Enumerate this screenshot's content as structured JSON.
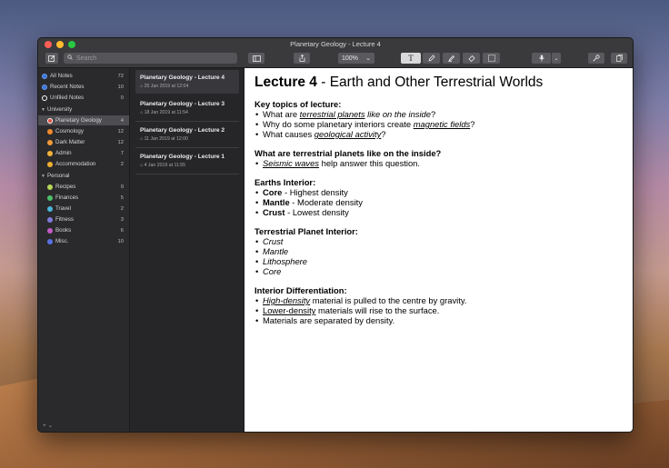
{
  "window": {
    "title": "Planetary Geology - Lecture 4"
  },
  "toolbar": {
    "search_placeholder": "Search",
    "zoom": "100%",
    "zoom_caret": "⌄"
  },
  "sidebar": {
    "top_items": [
      {
        "label": "All Notes",
        "count": "72",
        "color": "#3a76d8"
      },
      {
        "label": "Recent Notes",
        "count": "10",
        "color": "#3a76d8"
      },
      {
        "label": "Unfiled Notes",
        "count": "0",
        "color": "#ffffff"
      }
    ],
    "groups": [
      {
        "label": "University",
        "items": [
          {
            "label": "Planetary Geology",
            "count": "4",
            "color": "#e04b3c",
            "selected": true
          },
          {
            "label": "Cosmology",
            "count": "12",
            "color": "#ef8a2c"
          },
          {
            "label": "Dark Matter",
            "count": "12",
            "color": "#f09a3a"
          },
          {
            "label": "Admin",
            "count": "7",
            "color": "#f3b23a"
          },
          {
            "label": "Accommodation",
            "count": "2",
            "color": "#f0b030"
          }
        ]
      },
      {
        "label": "Personal",
        "items": [
          {
            "label": "Recipes",
            "count": "9",
            "color": "#b6d65a"
          },
          {
            "label": "Finances",
            "count": "5",
            "color": "#4cc16a"
          },
          {
            "label": "Travel",
            "count": "2",
            "color": "#4ab6d9"
          },
          {
            "label": "Fitness",
            "count": "3",
            "color": "#7f7cdb"
          },
          {
            "label": "Books",
            "count": "6",
            "color": "#c35cc8"
          },
          {
            "label": "Misc.",
            "count": "10",
            "color": "#5a6fe0"
          }
        ]
      }
    ],
    "footer": "+ ⌄"
  },
  "notes": [
    {
      "title": "Planetary Geology - Lecture 4",
      "date": "25 Jan 2019 at 12:04",
      "selected": true
    },
    {
      "title": "Planetary Geology - Lecture 3",
      "date": "18 Jan 2019 at 11:54"
    },
    {
      "title": "Planetary Geology - Lecture 2",
      "date": "11 Jan 2019 at 12:00"
    },
    {
      "title": "Planetary Geology - Lecture 1",
      "date": "4 Jan 2019 at 11:55"
    }
  ],
  "editor": {
    "title_bold": "Lecture 4",
    "title_rest": " - Earth and Other Terrestrial Worlds",
    "s1": {
      "heading": "Key topics of lecture:",
      "b1_a": "What are ",
      "b1_u": "terrestrial planets",
      "b1_i": " like on the inside",
      "b1_c": "?",
      "b2_a": "Why do some planetary interiors create ",
      "b2_u": "magnetic fields",
      "b2_c": "?",
      "b3_a": "What causes ",
      "b3_u": "geological activity",
      "b3_c": "?"
    },
    "s2": {
      "heading": "What are terrestrial planets like on the inside?",
      "b1_u": "Seismic waves",
      "b1_c": " help answer this question."
    },
    "s3": {
      "heading": "Earths Interior:",
      "b1_b": "Core",
      "b1_c": " - Highest density",
      "b2_b": "Mantle",
      "b2_c": " - Moderate density",
      "b3_b": "Crust",
      "b3_c": " - Lowest density"
    },
    "s4": {
      "heading": "Terrestrial Planet Interior:",
      "items": [
        "Crust",
        "Mantle",
        "Lithosphere",
        "Core"
      ]
    },
    "s5": {
      "heading": "Interior Differentiation:",
      "b1_u": "High-density",
      "b1_c": " material is pulled to the centre by gravity.",
      "b2_u": "Lower-density",
      "b2_c": " materials will rise to the surface.",
      "b3": "Materials are separated by density."
    }
  }
}
